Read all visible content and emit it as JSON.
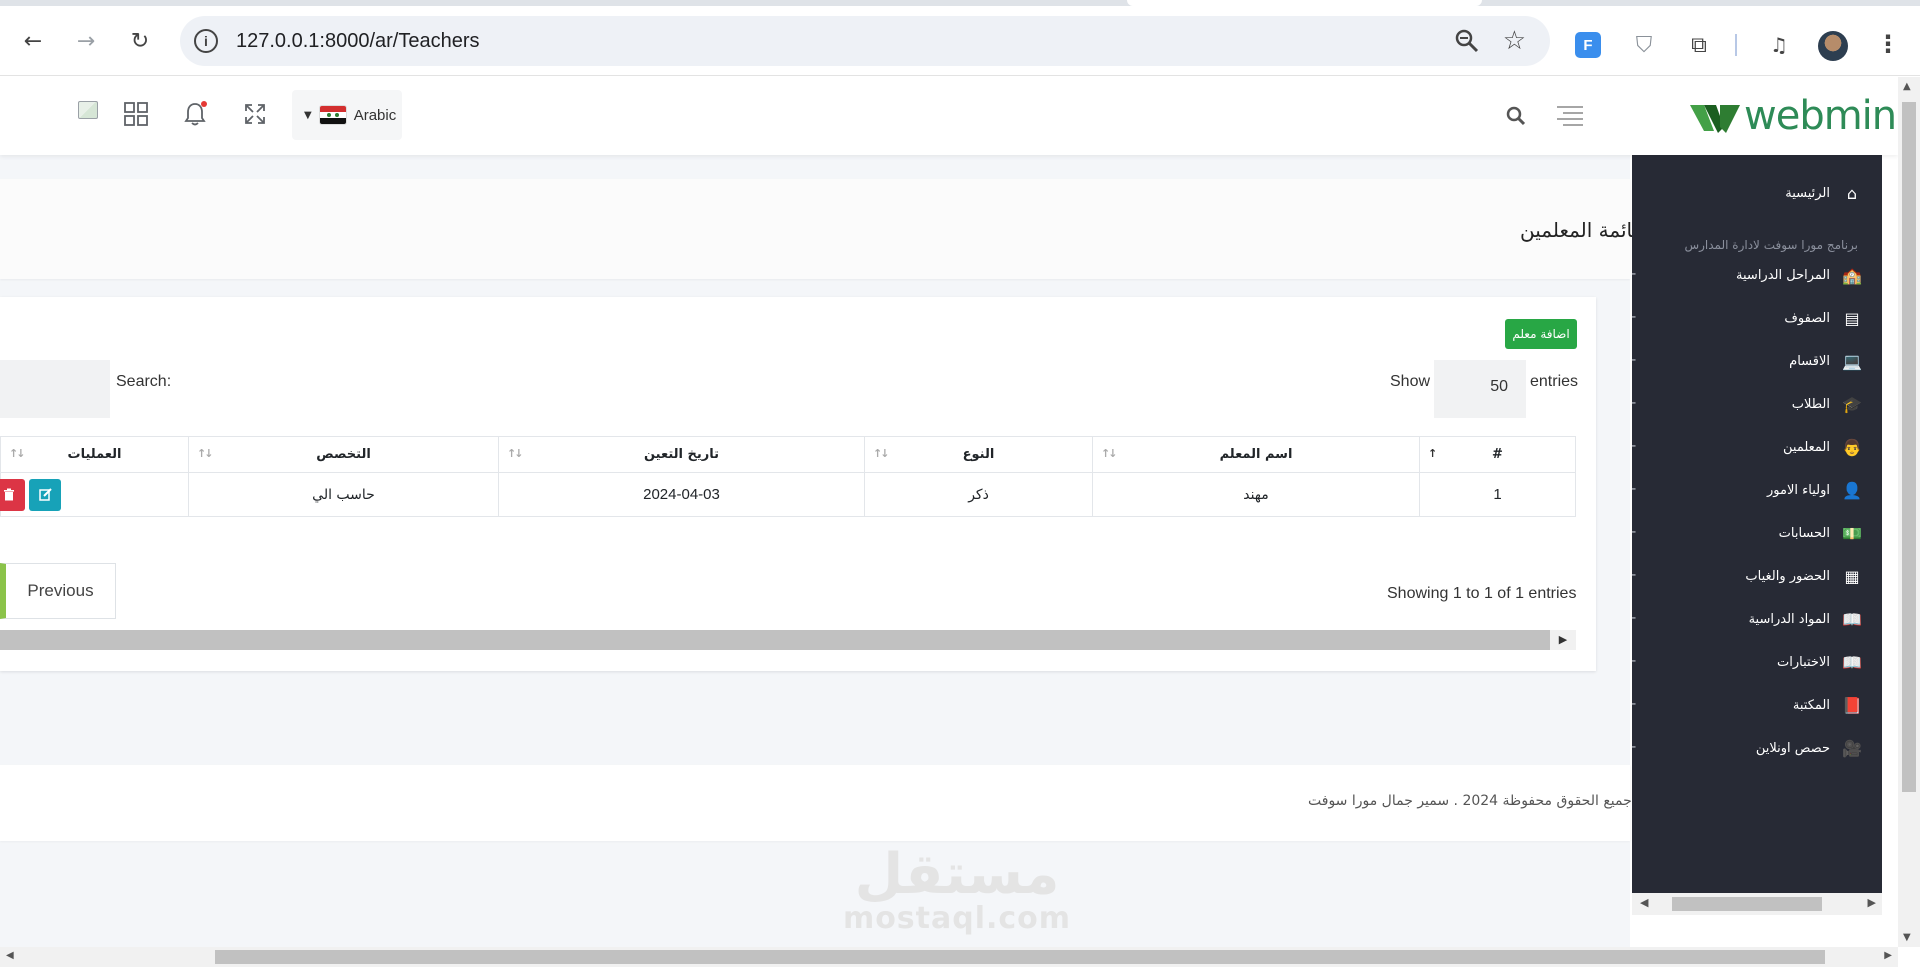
{
  "browser": {
    "url": "127.0.0.1:8000/ar/Teachers",
    "extension_label": "F"
  },
  "header": {
    "language": "Arabic",
    "brand": "webmin"
  },
  "page": {
    "title": "قائمة المعلمين",
    "add_button": "اضافة معلم"
  },
  "table_controls": {
    "show_label": "Show",
    "page_length": "50",
    "entries_label": "entries",
    "search_label": "Search:",
    "info": "Showing 1 to 1 of 1 entries",
    "previous": "Previous"
  },
  "table": {
    "columns": [
      "#",
      "اسم المعلم",
      "النوع",
      "تاريخ التعين",
      "التخصص",
      "العمليات"
    ],
    "rows": [
      {
        "num": "1",
        "name": "مهند",
        "gender": "ذكر",
        "date": "2024-04-03",
        "specialization": "حاسب الي"
      }
    ]
  },
  "footer": {
    "copyright": "© جميع الحقوق محفوظة 2024 . سمير جمال مورا سوفت"
  },
  "sidebar": {
    "home": "الرئيسية",
    "tagline": "برنامج مورا سوفت لادارة المدارس",
    "items": [
      {
        "label": "المراحل الدراسية",
        "icon": "school-icon",
        "glyph": "🏫"
      },
      {
        "label": "الصفوف",
        "icon": "building-icon",
        "glyph": "▤"
      },
      {
        "label": "الاقسام",
        "icon": "laptop-icon",
        "glyph": "💻"
      },
      {
        "label": "الطلاب",
        "icon": "student-icon",
        "glyph": "🎓"
      },
      {
        "label": "المعلمين",
        "icon": "teacher-icon",
        "glyph": "👨"
      },
      {
        "label": "اولياء الامور",
        "icon": "user-icon",
        "glyph": "👤"
      },
      {
        "label": "الحسابات",
        "icon": "money-icon",
        "glyph": "💵"
      },
      {
        "label": "الحضور والغياب",
        "icon": "calendar-icon",
        "glyph": "▦"
      },
      {
        "label": "المواد الدراسية",
        "icon": "book-icon",
        "glyph": "📖"
      },
      {
        "label": "الاختبارات",
        "icon": "book-open-icon",
        "glyph": "📖"
      },
      {
        "label": "المكتبة",
        "icon": "library-icon",
        "glyph": "📕"
      },
      {
        "label": "حصص اونلاين",
        "icon": "video-icon",
        "glyph": "🎥"
      }
    ]
  },
  "watermark": {
    "arabic": "مستقل",
    "latin": "mostaql.com"
  },
  "colors": {
    "sidebar_bg": "#272a35",
    "add_button": "#28a745",
    "edit_button": "#17a2b8",
    "delete_button": "#dc3545",
    "brand_green": "#2e8b57"
  }
}
